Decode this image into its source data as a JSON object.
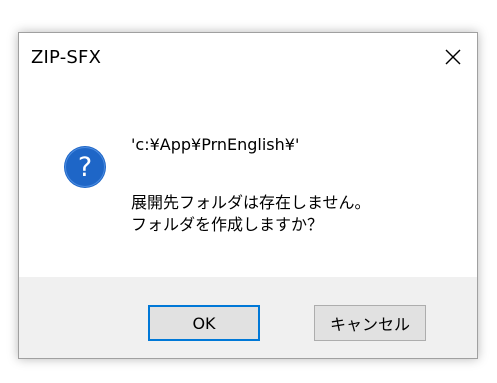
{
  "dialog": {
    "title": "ZIP-SFX",
    "close_icon": "close-icon",
    "message_icon": "question-icon",
    "message_path": "'c:¥App¥PrnEnglish¥'",
    "message_line1": "展開先フォルダは存在しません。",
    "message_line2": "フォルダを作成しますか？",
    "ok_label": "OK",
    "cancel_label": "キャンセル"
  },
  "colors": {
    "icon_blue": "#1e66c7",
    "focus_border": "#0078d7",
    "footer_bg": "#f0f0f0",
    "button_bg": "#e1e1e1"
  }
}
